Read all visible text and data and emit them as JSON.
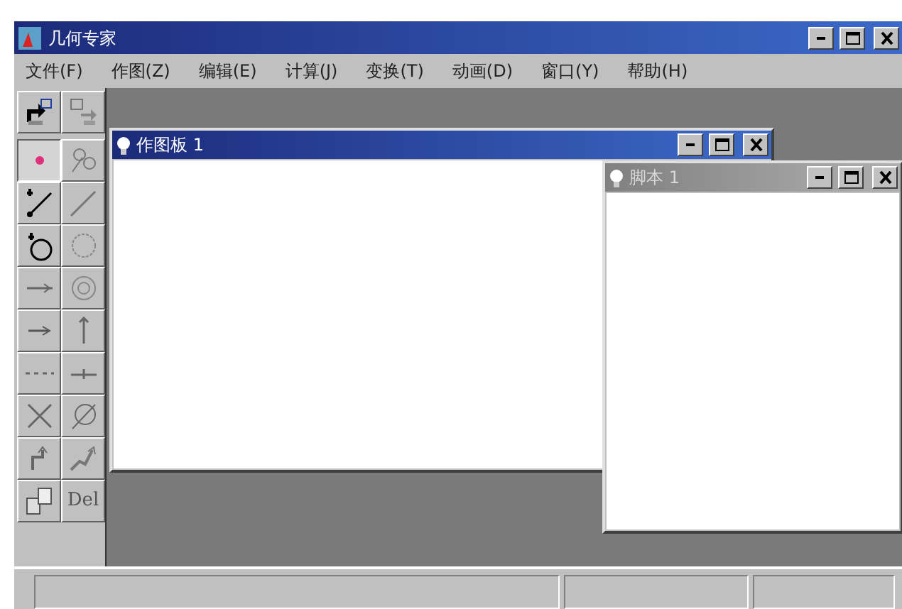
{
  "window": {
    "title": "几何专家"
  },
  "menu": [
    {
      "label": "文件(F)"
    },
    {
      "label": "作图(Z)"
    },
    {
      "label": "编辑(E)"
    },
    {
      "label": "计算(J)"
    },
    {
      "label": "变换(T)"
    },
    {
      "label": "动画(D)"
    },
    {
      "label": "窗口(Y)"
    },
    {
      "label": "帮助(H)"
    }
  ],
  "toolbox": [
    {
      "selected": false
    },
    {
      "selected": false
    },
    {
      "selected": true
    },
    {
      "selected": false
    },
    {
      "selected": false
    },
    {
      "selected": false
    },
    {
      "selected": false
    },
    {
      "selected": false
    },
    {
      "selected": false
    },
    {
      "selected": false
    },
    {
      "selected": false
    },
    {
      "selected": false
    },
    {
      "selected": false
    },
    {
      "selected": false
    },
    {
      "selected": false
    },
    {
      "selected": false
    },
    {
      "selected": false
    },
    {
      "selected": false
    },
    {
      "selected": false
    },
    {
      "selected": false,
      "label": "Del"
    }
  ],
  "sketch_window": {
    "title": "作图板 1",
    "active": true
  },
  "script_window": {
    "title": "脚本 1",
    "active": false
  }
}
